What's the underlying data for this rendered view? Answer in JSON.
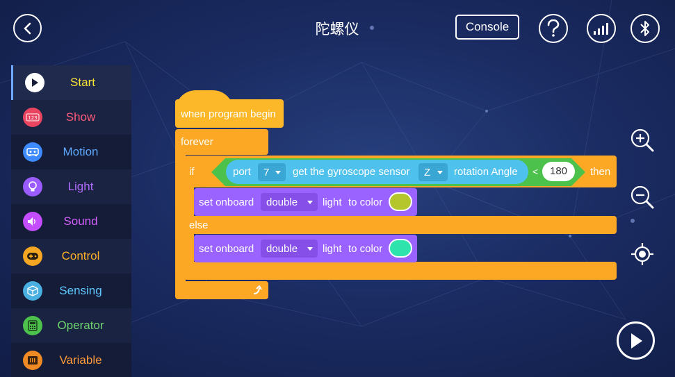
{
  "header": {
    "title": "陀螺仪",
    "console_label": "Console"
  },
  "sidebar": {
    "items": [
      {
        "label": "Start",
        "color": "#fde433",
        "icon": "play-icon"
      },
      {
        "label": "Show",
        "color": "#ff5a7a",
        "icon": "display-123-icon"
      },
      {
        "label": "Motion",
        "color": "#5ea8ff",
        "icon": "robot-icon"
      },
      {
        "label": "Light",
        "color": "#b26bff",
        "icon": "bulb-icon"
      },
      {
        "label": "Sound",
        "color": "#d65eff",
        "icon": "speaker-icon"
      },
      {
        "label": "Control",
        "color": "#fdb02a",
        "icon": "gamepad-icon"
      },
      {
        "label": "Sensing",
        "color": "#5ec8ff",
        "icon": "cube-icon"
      },
      {
        "label": "Operator",
        "color": "#6fd66f",
        "icon": "calculator-icon"
      },
      {
        "label": "Variable",
        "color": "#ff9a3a",
        "icon": "variable-box-icon"
      }
    ]
  },
  "blocks": {
    "hat_label": "when program begin",
    "forever_label": "forever",
    "if_label": "if",
    "then_label": "then",
    "else_label": "else",
    "sensor": {
      "port_label": "port",
      "port_value": "7",
      "get_label": "get the gyroscope sensor",
      "axis_value": "Z",
      "angle_label": "rotation Angle"
    },
    "compare_op": "<",
    "compare_value": "180",
    "set1": {
      "set_label": "set onboard",
      "target": "double",
      "light_label": "light",
      "to_color_label": "to color",
      "color": "#b5c62c"
    },
    "set2": {
      "set_label": "set onboard",
      "target": "double",
      "light_label": "light",
      "to_color_label": "to color",
      "color": "#2fe3ad"
    }
  },
  "colors": {
    "hat": "#fdb82a",
    "control": "#fca825",
    "sensing": "#4fc1ed",
    "operator": "#4cc14c",
    "light": "#9a63ff"
  }
}
